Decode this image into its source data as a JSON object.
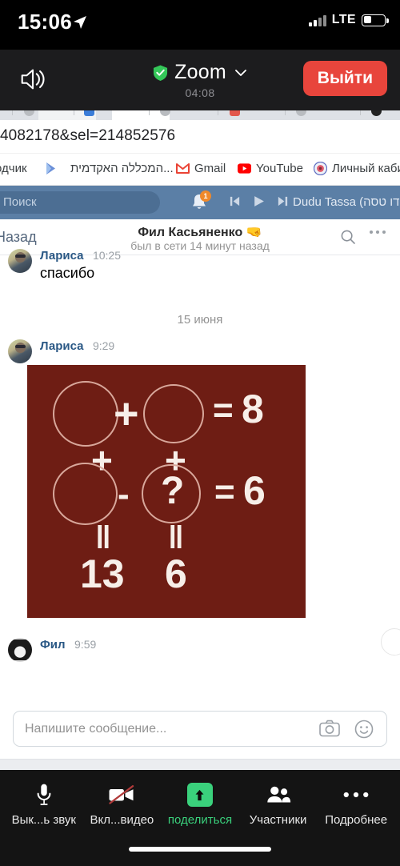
{
  "status_bar": {
    "time": "15:06",
    "location_icon": "location-arrow-icon",
    "network": "LTE",
    "signal_icon": "signal-bars-icon",
    "battery_icon": "battery-icon"
  },
  "zoom_header": {
    "speaker_icon": "speaker-icon",
    "shield_icon": "shield-check-icon",
    "app_title": "Zoom",
    "chevron_icon": "chevron-down-icon",
    "timer": "04:08",
    "leave_label": "Выйти",
    "leave_color": "#e8453c"
  },
  "shared_screen": {
    "browser": {
      "url": "4082178&sel=214852576",
      "bookmarks": [
        {
          "label": "одчик",
          "icon": "bookmark-icon"
        },
        {
          "label": "",
          "icon": "play-store-icon"
        },
        {
          "label": "המכללה האקדמית...",
          "icon": "none"
        },
        {
          "label": "Gmail",
          "icon": "gmail-icon"
        },
        {
          "label": "YouTube",
          "icon": "youtube-icon"
        },
        {
          "label": "Личный кабин",
          "icon": "target-icon"
        }
      ]
    },
    "vk_nav": {
      "search_placeholder": "Поиск",
      "bell_icon": "bell-icon",
      "bell_badge": "1",
      "prev_icon": "skip-previous-icon",
      "play_icon": "play-icon",
      "next_icon": "skip-next-icon",
      "track_title": "Dudu Tassa (דודו טסה)"
    },
    "vk_chat_header": {
      "back_label": "Назад",
      "contact_name": "Фил Касьяненко",
      "contact_emoji": "🤜",
      "status": "был в сети 14 минут назад",
      "search_icon": "search-icon",
      "more_icon": "more-horizontal-icon"
    },
    "messages": [
      {
        "author": "Лариса",
        "time": "10:25",
        "text": "спасибо",
        "avatar": "larisa-avatar"
      },
      {
        "author": "Лариса",
        "time": "9:29",
        "text": "",
        "avatar": "larisa-avatar"
      },
      {
        "author": "Фил",
        "time": "9:59",
        "text": "",
        "avatar": "fil-avatar"
      }
    ],
    "date_separator": "15 июня",
    "puzzle_image": {
      "background_color": "#6e1d14",
      "circle_stroke": "#d8a79b",
      "text_color": "#f5ece6",
      "row1_operator": "+",
      "row1_result_equals": "=",
      "row1_result": "8",
      "col_operator_left": "+",
      "col_operator_right": "+",
      "row2_operator": "-",
      "row2_unknown": "?",
      "row2_result_equals": "=",
      "row2_result": "6",
      "col_equals_left": "‖",
      "col_equals_right": "‖",
      "col_total_left": "13",
      "col_total_right": "6"
    },
    "message_input": {
      "placeholder": "Напишите сообщение...",
      "camera_icon": "camera-icon",
      "emoji_icon": "smiley-icon"
    }
  },
  "zoom_toolbar": {
    "items": [
      {
        "label": "Вык...ь звук",
        "icon": "microphone-icon",
        "highlight": false
      },
      {
        "label": "Вкл...видео",
        "icon": "video-off-icon",
        "highlight": false
      },
      {
        "label": "поделиться",
        "icon": "share-up-arrow-icon",
        "highlight": true
      },
      {
        "label": "Участники",
        "icon": "participants-icon",
        "highlight": false
      },
      {
        "label": "Подробнее",
        "icon": "more-horizontal-icon",
        "highlight": false
      }
    ],
    "accent_color": "#3ad17c"
  }
}
